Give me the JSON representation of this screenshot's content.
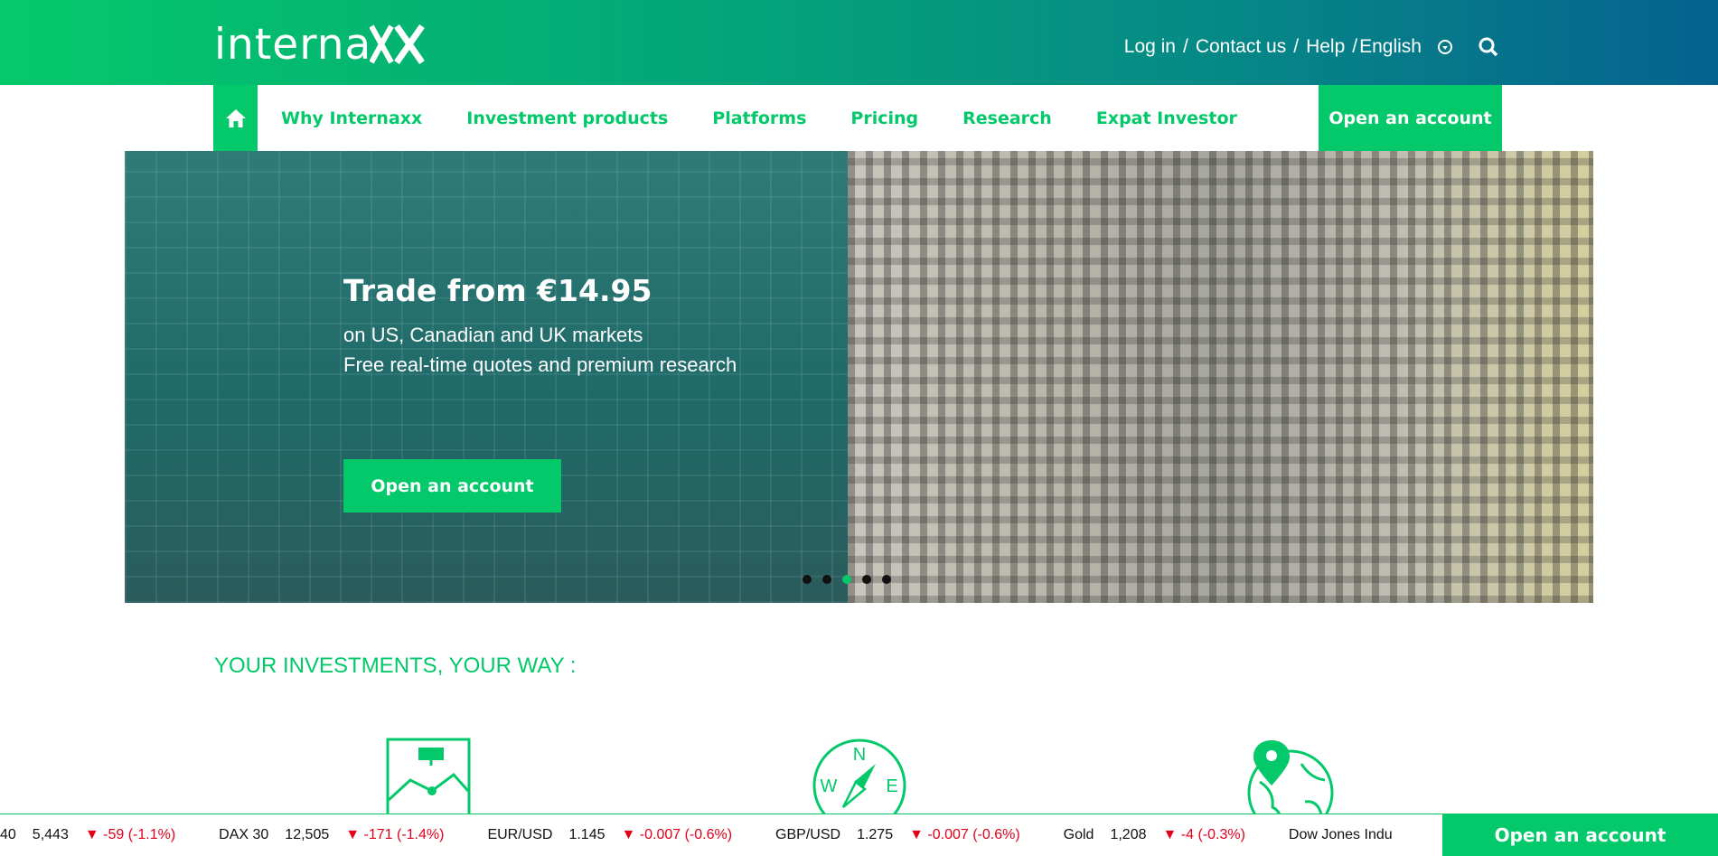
{
  "brand": {
    "name": "interna",
    "colors": {
      "accent": "#04c96a",
      "down": "#e3001b"
    }
  },
  "utility": {
    "login": "Log in",
    "contact": "Contact us",
    "help": "Help",
    "language": "English",
    "separator": "/"
  },
  "nav": {
    "items": [
      "Why Internaxx",
      "Investment products",
      "Platforms",
      "Pricing",
      "Research",
      "Expat Investor"
    ],
    "cta": "Open an account"
  },
  "hero": {
    "title": "Trade from €14.95",
    "sub1": "on US, Canadian and UK markets",
    "sub2": "Free real-time quotes and premium research",
    "cta": "Open an account",
    "slide_count": 5,
    "active_slide": 3
  },
  "section": {
    "title": "YOUR INVESTMENTS, YOUR WAY :"
  },
  "ticker": {
    "items": [
      {
        "name": "40",
        "value": "5,443",
        "change": "▼ -59 (-1.1%)"
      },
      {
        "name": "DAX 30",
        "value": "12,505",
        "change": "▼ -171 (-1.4%)"
      },
      {
        "name": "EUR/USD",
        "value": "1.145",
        "change": "▼ -0.007 (-0.6%)"
      },
      {
        "name": "GBP/USD",
        "value": "1.275",
        "change": "▼ -0.007 (-0.6%)"
      },
      {
        "name": "Gold",
        "value": "1,208",
        "change": "▼ -4 (-0.3%)"
      },
      {
        "name": "Dow Jones Indu",
        "value": "",
        "change": ""
      }
    ],
    "cta": "Open an account"
  },
  "icons": {
    "home": "home-icon",
    "search": "search-icon",
    "language": "language-dropdown-icon",
    "chart": "chart-board-icon",
    "compass": "compass-icon",
    "globe": "globe-pin-icon"
  }
}
